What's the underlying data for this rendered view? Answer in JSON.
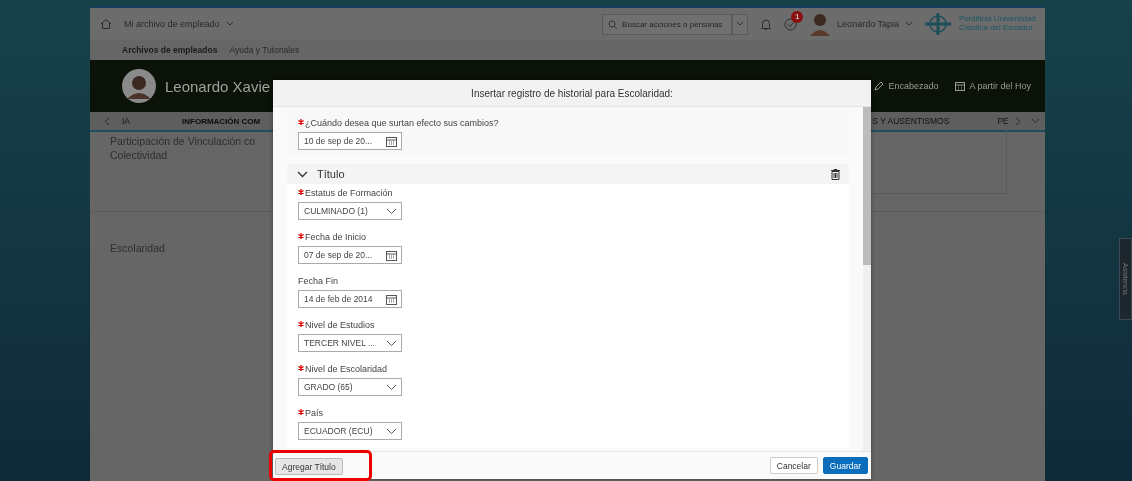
{
  "top_bar": {
    "breadcrumb": "Mi archivo de empleado",
    "search": {
      "placeholder": "Buscar acciones o personas"
    },
    "todo_badge": "1",
    "user_name": "Leonardo Tapia",
    "logo_lines": [
      "Pontificia Universidad",
      "Católica del Ecuador"
    ]
  },
  "sub_nav": [
    {
      "label": "Archivos de empleados",
      "selected": true
    },
    {
      "label": "Ayuda y Tutoriales",
      "selected": false
    }
  ],
  "header": {
    "name": "Leonardo Xavie",
    "actions": [
      {
        "kind": "edit",
        "label": "Encabezado"
      },
      {
        "kind": "calendar",
        "label": "A partir del Hoy"
      }
    ]
  },
  "tabs": [
    {
      "label": "IA",
      "selected": false
    },
    {
      "label": "INFORMACIÓN COM",
      "selected": true
    },
    {
      "label": "S Y AUSENTISMOS",
      "selected": false
    },
    {
      "label": "PE",
      "selected": false
    }
  ],
  "sections": [
    {
      "title_lines": [
        "Participación de Vinculación co",
        "Colectividad"
      ]
    },
    {
      "title_lines": [
        "Escolaridad"
      ]
    }
  ],
  "side_tab": "Asistencia",
  "dialog": {
    "title": "Insertar registro de historial para Escolaridad:",
    "effective_date": {
      "label": "¿Cuándo desea que surtan efecto sus cambios?",
      "required": true,
      "kind": "date",
      "value": "10 de sep de 20..."
    },
    "section": {
      "title": "Título",
      "expanded": true,
      "fields": [
        {
          "label": "Estatus de Formación",
          "required": true,
          "kind": "select",
          "value": "CULMINADO (1)"
        },
        {
          "label": "Fecha de Inicio",
          "required": true,
          "kind": "date",
          "value": "07 de sep de 20..."
        },
        {
          "label": "Fecha Fin",
          "required": false,
          "kind": "date",
          "value": "14 de feb de 2014"
        },
        {
          "label": "Nivel de Estudios",
          "required": true,
          "kind": "select",
          "value": "TERCER NIVEL ..."
        },
        {
          "label": "Nivel de Escolaridad",
          "required": true,
          "kind": "select",
          "value": "GRADO (65)"
        },
        {
          "label": "País",
          "required": true,
          "kind": "select",
          "value": "ECUADOR (ECU)"
        }
      ]
    },
    "add_button": {
      "label": "Agregar Título",
      "highlighted": true
    },
    "buttons": [
      {
        "kind": "secondary",
        "label": "Cancelar"
      },
      {
        "kind": "primary",
        "label": "Guardar"
      }
    ]
  }
}
